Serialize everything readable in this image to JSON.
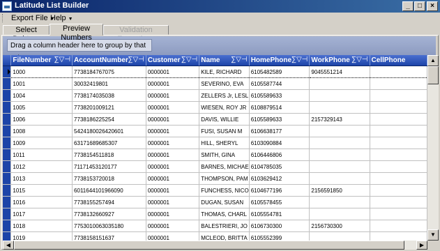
{
  "window": {
    "title": "Latitude List Builder",
    "controls": [
      "_",
      "□",
      "×"
    ]
  },
  "menu": [
    {
      "label": "Export File"
    },
    {
      "label": "Help"
    }
  ],
  "tabs": [
    {
      "label": "Select Debtors",
      "state": "normal"
    },
    {
      "label": "Preview Numbers",
      "state": "active"
    },
    {
      "label": "Validation Exceptions",
      "state": "disabled"
    }
  ],
  "group_panel": {
    "hint": "Drag a column header here to group by that column."
  },
  "grid": {
    "columns": [
      {
        "label": "FileNumber"
      },
      {
        "label": "AccountNumber"
      },
      {
        "label": "Customer"
      },
      {
        "label": "Name"
      },
      {
        "label": "HomePhone"
      },
      {
        "label": "WorkPhone"
      },
      {
        "label": "CellPhone"
      }
    ],
    "header_icons": "∑▽⊣",
    "rows": [
      [
        "1000",
        "7738184767075",
        "0000001",
        "KILE, RICHARD",
        "6105482589",
        "9045551214",
        ""
      ],
      [
        "1001",
        "30032419801",
        "0000001",
        "SEVERINO, EVA",
        "6105587744",
        "",
        ""
      ],
      [
        "1004",
        "7738174035038",
        "0000001",
        "ZELLERS Jr, LESL",
        "6105589633",
        "",
        ""
      ],
      [
        "1005",
        "7738201009121",
        "0000001",
        "WIESEN, ROY JR",
        "6108879514",
        "",
        ""
      ],
      [
        "1006",
        "7738186225254",
        "0000001",
        "DAVIS, WILLIE",
        "6105589633",
        "2157329143",
        ""
      ],
      [
        "1008",
        "5424180026420601",
        "0000001",
        "FUSI, SUSAN M",
        "6106638177",
        "",
        ""
      ],
      [
        "1009",
        "63171689685307",
        "0000001",
        "HILL, SHERYL",
        "6103090884",
        "",
        ""
      ],
      [
        "1011",
        "7738154511818",
        "0000001",
        "SMITH, GINA",
        "6106446806",
        "",
        ""
      ],
      [
        "1012",
        "71171453120177",
        "0000001",
        "BARNES, MICHAE",
        "6104785035",
        "",
        ""
      ],
      [
        "1013",
        "7738153720018",
        "0000001",
        "THOMPSON, PAM",
        "6103629412",
        "",
        ""
      ],
      [
        "1015",
        "6011644101966090",
        "0000001",
        "FUNCHESS, NICO",
        "6104677196",
        "2156591850",
        ""
      ],
      [
        "1016",
        "7738155257494",
        "0000001",
        "DUGAN, SUSAN",
        "6105578455",
        "",
        ""
      ],
      [
        "1017",
        "7738132660927",
        "0000001",
        "THOMAS, CHARL",
        "6105554781",
        "",
        ""
      ],
      [
        "1018",
        "7753010063035180",
        "0000001",
        "BALESTRIERI, JO",
        "6106730300",
        "2156730300",
        ""
      ],
      [
        "1019",
        "7738158151637",
        "0000001",
        "MCLEOD, BRITTA",
        "6105552399",
        "",
        ""
      ]
    ]
  },
  "colors": {
    "title_bar": "#0a246a",
    "header": "#1c44a8",
    "group_panel": "#a5b3d4"
  }
}
